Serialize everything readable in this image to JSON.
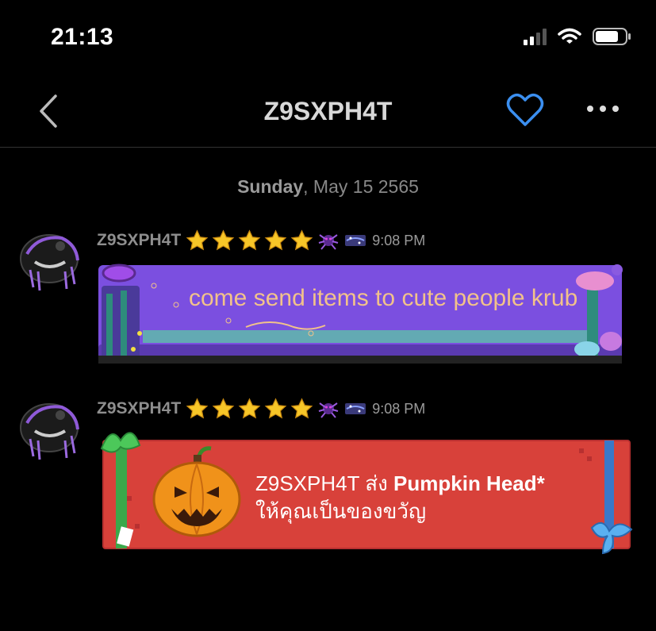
{
  "status_bar": {
    "time": "21:13"
  },
  "header": {
    "title": "Z9SXPH4T"
  },
  "date": {
    "day": "Sunday",
    "rest": ", May 15 2565"
  },
  "messages": [
    {
      "sender": "Z9SXPH4T",
      "time": "9:08 PM",
      "text": "come send items to cute people krub"
    },
    {
      "sender": "Z9SXPH4T",
      "time": "9:08 PM",
      "gift_sender": "Z9SXPH4T ส่ง ",
      "gift_item": "Pumpkin Head*",
      "gift_line2": "ให้คุณเป็นของขวัญ"
    }
  ],
  "colors": {
    "accent": "#3b8ff0",
    "bubble_purple": "#7b4fe0",
    "bubble_gift": "#d8413a",
    "bubble_text": "#f2c28a"
  },
  "icons": [
    "back-icon",
    "heart-icon",
    "more-icon",
    "star-icon",
    "wifi-icon",
    "battery-icon",
    "signal-icon"
  ]
}
